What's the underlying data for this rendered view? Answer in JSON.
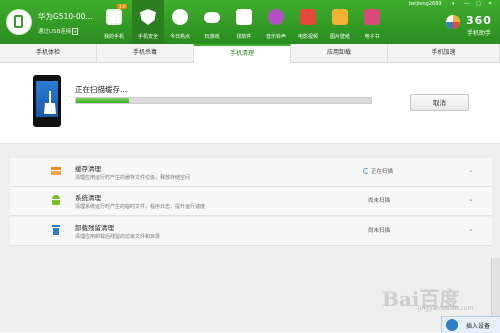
{
  "device": {
    "name": "华为G510-00...",
    "connection": "通过USB连接",
    "conn_toggle": "▾"
  },
  "nav": [
    {
      "label": "我的手机",
      "icon": "my-phone-icon",
      "badge": "1.0"
    },
    {
      "label": "手机安全",
      "icon": "shield-icon",
      "active": true
    },
    {
      "label": "今日热点",
      "icon": "hot-news-icon"
    },
    {
      "label": "玩游戏",
      "icon": "gamepad-icon"
    },
    {
      "label": "找软件",
      "icon": "software-icon"
    },
    {
      "label": "音乐铃声",
      "icon": "music-icon"
    },
    {
      "label": "电影视频",
      "icon": "video-icon"
    },
    {
      "label": "图片壁纸",
      "icon": "wallpaper-icon"
    },
    {
      "label": "电子书",
      "icon": "ebook-icon"
    }
  ],
  "user": "beijieng2689",
  "window_controls": [
    "▾",
    "—",
    "□",
    "✕"
  ],
  "logo": {
    "text": "360",
    "subtitle": "手机助手"
  },
  "tabs": [
    "手机体检",
    "手机杀毒",
    "手机清理",
    "应用卸载",
    "手机加速"
  ],
  "active_tab": "手机清理",
  "scan": {
    "status_text": "正在扫描缓存...",
    "progress": 0.18,
    "cancel_label": "取消"
  },
  "items": [
    {
      "icon": "cache-clean-icon",
      "title": "缓存清理",
      "desc": "清理应用运行时产生的缓存文件垃圾，释放存储空间",
      "status": "正在扫描",
      "scanning": true,
      "chevron": "⌄"
    },
    {
      "icon": "android-icon",
      "title": "系统清理",
      "desc": "清理系统运行时产生的临时文件，程序日志，提升运行速度",
      "status": "尚未扫描",
      "scanning": false,
      "chevron": "⌄"
    },
    {
      "icon": "trash-icon",
      "title": "卸载残留清理",
      "desc": "清理应用卸载后残留的垃圾文件和目录",
      "status": "尚未扫描",
      "scanning": false,
      "chevron": "⌄"
    }
  ],
  "watermark": {
    "brand": "Bai",
    "brand2": "百度",
    "sub": "jingyan.baidu.com"
  },
  "popup": {
    "text": "插入设备"
  },
  "colors": {
    "brand_green": "#3fae2d",
    "accent_blue": "#5aa0d8",
    "progress_fill": "#3fae2d"
  }
}
